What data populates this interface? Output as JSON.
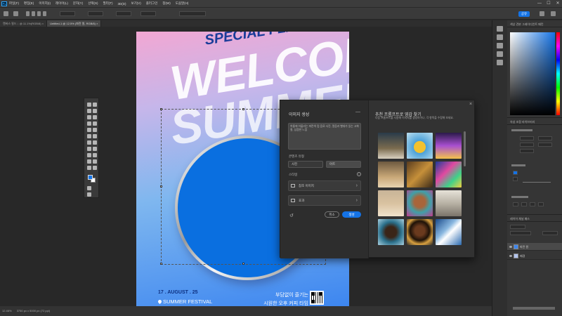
{
  "menu": {
    "app_icon": "Ps",
    "items": [
      "파일(F)",
      "편집(E)",
      "이미지(I)",
      "레이어(L)",
      "문자(Y)",
      "선택(S)",
      "필터(T)",
      "3D(D)",
      "보기(V)",
      "플러그인",
      "창(W)",
      "도움말(H)"
    ],
    "window_controls": [
      "—",
      "☐",
      "✕"
    ]
  },
  "optionsbar": {
    "share_label": "공유"
  },
  "tabs": [
    {
      "label": "캔버스 필드 ↓ @ 11.1%(RGB/8) ×",
      "active": false
    },
    {
      "label": "Untitled-1 @ 12.5% (파란 원, RGB/8) ×",
      "active": true
    }
  ],
  "poster": {
    "special": "SPECIAL FLAVOR",
    "welcome": "WELCOME",
    "summer": "SUMMER",
    "date": "17 . AUGUST . 25",
    "festival": "SUMMER FESTIVAL",
    "korean_line1": "부담없이 즐기는",
    "korean_line2": "시원한 오후 커피 타임"
  },
  "statusbar": {
    "zoom": "12.46%",
    "doc_info": "3750 px x 5000 px (72 ppi)"
  },
  "dialog": {
    "title": "이미지 생성",
    "prompt_text": "여름에 어울리는 파란색 컵 음료 사진, 얼음과 빨대가 있는 고화질, 상큼한 느낌",
    "content_type_label": "콘텐츠 유형",
    "content_options": [
      "사진",
      "아트"
    ],
    "style_label": "스타일",
    "reference_label": "참조 이미지",
    "effects_label": "효과",
    "cancel_label": "취소",
    "generate_label": "생성",
    "right_title": "추천 프롬프트로 영감 찾기",
    "right_subtitle": "다음 프롬프트를 사용해 이미지를 생성하거나, 각 항목을 수정해 보세요."
  },
  "colors": {
    "accent": "#1473e6",
    "circle": "#0a6fe0",
    "panel": "#353535",
    "workspace": "#282828"
  },
  "right_panel": {
    "color_tabs": "색상  견본  그레이디언트  패턴",
    "props_tabs": "속성  조정  라이브러리",
    "layers_tabs": "레이어  채널  패스",
    "layers": [
      {
        "name": "파란 원",
        "selected": true
      },
      {
        "name": "배경",
        "selected": false
      }
    ]
  }
}
